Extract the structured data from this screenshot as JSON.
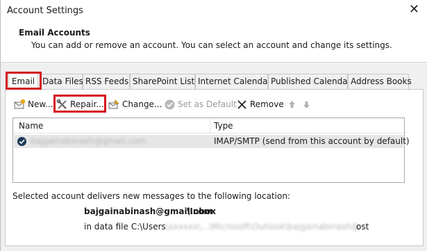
{
  "window": {
    "title": "Account Settings",
    "close_glyph": "✕"
  },
  "header": {
    "section_title": "Email Accounts",
    "description": "You can add or remove an account. You can select an account and change its settings."
  },
  "tabs": [
    {
      "label": "Email",
      "active": true,
      "highlighted": true
    },
    {
      "label": "Data Files",
      "active": false
    },
    {
      "label": "RSS Feeds",
      "active": false
    },
    {
      "label": "SharePoint Lists",
      "active": false
    },
    {
      "label": "Internet Calendars",
      "active": false
    },
    {
      "label": "Published Calendars",
      "active": false
    },
    {
      "label": "Address Books",
      "active": false
    }
  ],
  "toolbar": {
    "new_label": "New...",
    "repair_label": "Repair...",
    "change_label": "Change...",
    "set_default_label": "Set as Default",
    "remove_label": "Remove",
    "icons": {
      "new": "new-mail-icon",
      "repair": "tools-icon",
      "change": "change-icon",
      "set_default": "check-circle-icon",
      "remove": "x-icon",
      "move_up": "arrow-up-icon",
      "move_down": "arrow-down-icon"
    }
  },
  "accounts_table": {
    "columns": [
      "Name",
      "Type"
    ],
    "rows": [
      {
        "name": "bajgainabinash@gmail.com",
        "type": "IMAP/SMTP (send from this account by default)",
        "selected": true
      }
    ]
  },
  "delivery": {
    "label": "Selected account delivers new messages to the following location:",
    "mailbox": "bajgainabinash@gmail.com",
    "folder": "\\Inbox",
    "datafile_prefix": "in data file C:\\Users",
    "datafile_hidden": "\\xxxxxx\\...\\Microsoft\\Outlook\\bajgainabinash@gmail.com.",
    "datafile_ext": "ost"
  },
  "colors": {
    "highlight_red": "#d3121d",
    "selected_row": "#e6e6e6",
    "account_icon": "#1f3a5a"
  }
}
